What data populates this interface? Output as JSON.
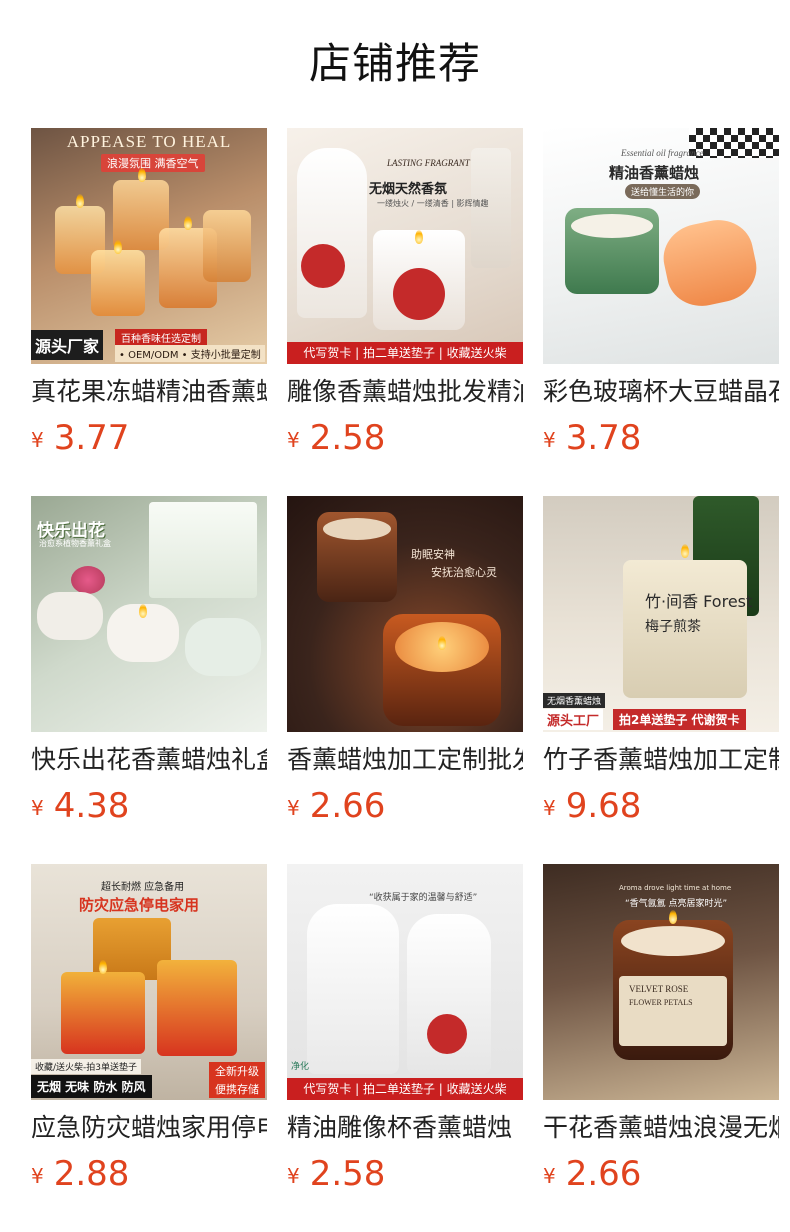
{
  "page": {
    "title": "店铺推荐"
  },
  "products": [
    {
      "name": "真花果冻蜡精油香薰蜡烛",
      "currency": "¥",
      "price": "3.77",
      "img": {
        "bg1": "#7a5a45",
        "bg2": "#d9b48a",
        "accent": "#f2b870",
        "top_text": "APPEASE TO HEAL",
        "sub_text": "浪漫氛围 满香空气",
        "badge_main": "源头厂家",
        "badge_line1": "百种香味任选定制",
        "badge_line2": "• OEM/ODM • 支持小批量定制"
      }
    },
    {
      "name": "雕像香薰蜡烛批发精油",
      "currency": "¥",
      "price": "2.58",
      "img": {
        "bg1": "#e9e2da",
        "bg2": "#f7f1ea",
        "accent": "#c42a2a",
        "top_text": "LASTING FRAGRANT",
        "sub_text": "无烟天然香氛",
        "small_text": "一缕烛火 / 一缕清香 | 影辉情趣",
        "strip": "代写贺卡 | 拍二单送垫子 | 收藏送火柴"
      }
    },
    {
      "name": "彩色玻璃杯大豆蜡晶石",
      "currency": "¥",
      "price": "3.78",
      "img": {
        "bg1": "#e9ebec",
        "bg2": "#ffffff",
        "accent": "#4a8a5a",
        "top_text": "Essential oil fragrance",
        "sub_text": "精油香薰蜡烛",
        "small_text": "送给懂生活的你"
      }
    },
    {
      "name": "快乐出花香薰蜡烛礼盒",
      "currency": "¥",
      "price": "4.38",
      "img": {
        "bg1": "#b9c7b3",
        "bg2": "#e8efe6",
        "accent": "#e65a8a",
        "top_text": "快乐出花",
        "sub_text": "治愈系植物香薰礼盒"
      }
    },
    {
      "name": "香薰蜡烛加工定制批发",
      "currency": "¥",
      "price": "2.66",
      "img": {
        "bg1": "#3a241c",
        "bg2": "#6e3a25",
        "accent": "#e08a3a",
        "top_text": "助眠安神",
        "sub_text": "安抚治愈心灵"
      }
    },
    {
      "name": "竹子香薰蜡烛加工定制",
      "currency": "¥",
      "price": "9.68",
      "img": {
        "bg1": "#cfc6b8",
        "bg2": "#ede6da",
        "accent": "#6d7b4a",
        "jar_text": "竹·间香 Forest",
        "jar_sub": "梅子煎茶",
        "badge_top": "无烟香薰蜡烛",
        "badge_main": "源头工厂",
        "badge_tail": "拍2单送垫子 代谢贺卡"
      }
    },
    {
      "name": "应急防灾蜡烛家用停电",
      "currency": "¥",
      "price": "2.88",
      "img": {
        "bg1": "#d8d2c8",
        "bg2": "#efe9df",
        "accent": "#d7341f",
        "top_text": "超长耐燃 应急备用",
        "sub_text": "防灾应急停电家用",
        "strip_a": "收藏/送火柴-拍3单送垫子",
        "strip_b": "无烟 无味 防水 防风",
        "badge_r1": "全新升级",
        "badge_r2": "便携存储"
      }
    },
    {
      "name": "精油雕像杯香薰蜡烛",
      "currency": "¥",
      "price": "2.58",
      "img": {
        "bg1": "#e6e6e6",
        "bg2": "#f6f6f6",
        "accent": "#c42a2a",
        "top_text": "“收获属于家的温馨与舒适”",
        "small_text": "净化",
        "strip": "代写贺卡 | 拍二单送垫子 | 收藏送火柴"
      }
    },
    {
      "name": "干花香薰蜡烛浪漫无烟",
      "currency": "¥",
      "price": "2.66",
      "img": {
        "bg1": "#5a4030",
        "bg2": "#c8b293",
        "accent": "#8a3a1e",
        "top_text": "Aroma drove light time at home",
        "sub_text": "“香气氤氲 点亮居家时光”",
        "jar_text": "VELVET ROSE",
        "jar_sub": "FLOWER PETALS"
      }
    }
  ]
}
